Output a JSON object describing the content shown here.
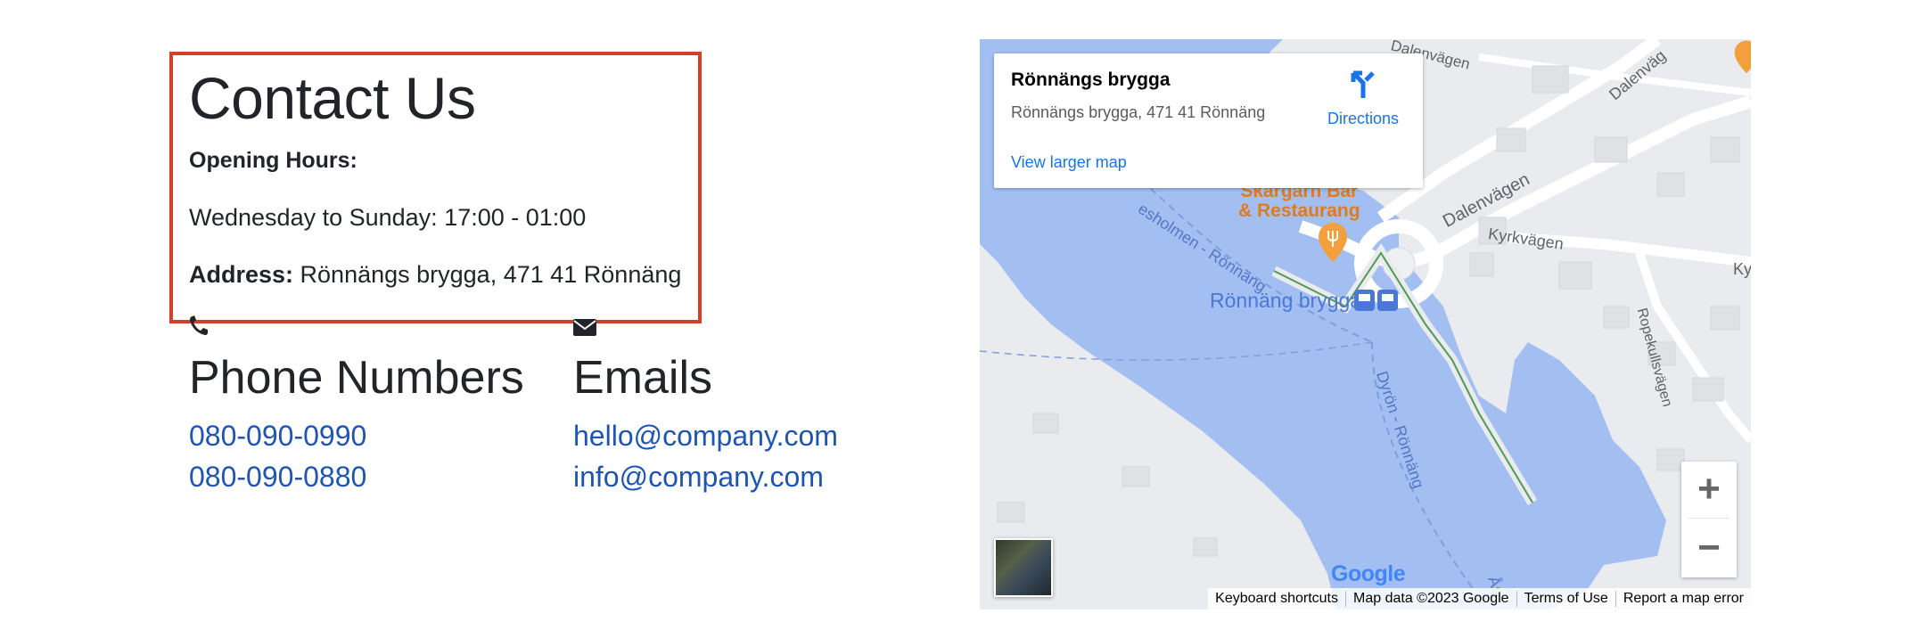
{
  "contact": {
    "title": "Contact Us",
    "opening_hours_label": "Opening Hours:",
    "opening_hours_text": "Wednesday to Sunday: 17:00 - 01:00",
    "address_label": "Address:",
    "address_value": "Rönnängs brygga, 471 41 Rönnäng"
  },
  "phones": {
    "title": "Phone Numbers",
    "icon": "phone-icon",
    "items": [
      "080-090-0990",
      "080-090-0880"
    ]
  },
  "emails": {
    "title": "Emails",
    "icon": "envelope-icon",
    "items": [
      "hello@company.com",
      "info@company.com"
    ]
  },
  "map": {
    "place_name": "Rönnängs brygga",
    "place_address": "Rönnängs brygga, 471 41 Rönnäng",
    "directions_label": "Directions",
    "view_larger_map": "View larger map",
    "zoom_in": "+",
    "zoom_out": "−",
    "logo": "Google",
    "labels": {
      "street_1": "Dalenvägen",
      "street_2": "Dalenvägen",
      "street_3": "Dalenväg",
      "street_4": "Kyrkvägen",
      "street_5": "Kyr",
      "street_6": "Ropekullsvägen",
      "ferry_1": "esholmen - Rönnäng",
      "ferry_2": "Dyrön - Rönnäng",
      "ferry_3": "Ås",
      "restaurant_line1": "Skärgårn Bar",
      "restaurant_line2": "& Restaurang",
      "stop": "Rönnäng brygga"
    },
    "attribution": {
      "shortcuts": "Keyboard shortcuts",
      "map_data": "Map data ©2023 Google",
      "terms": "Terms of Use",
      "report": "Report a map error"
    },
    "colors": {
      "water": "#a3bff2",
      "land": "#e9ebee",
      "road": "#ffffff",
      "link_blue": "#1a73e8",
      "poi_orange": "#f29f3c"
    }
  },
  "colors": {
    "highlight_border": "#d43f2a",
    "link": "#1f55b2",
    "text": "#212529"
  }
}
